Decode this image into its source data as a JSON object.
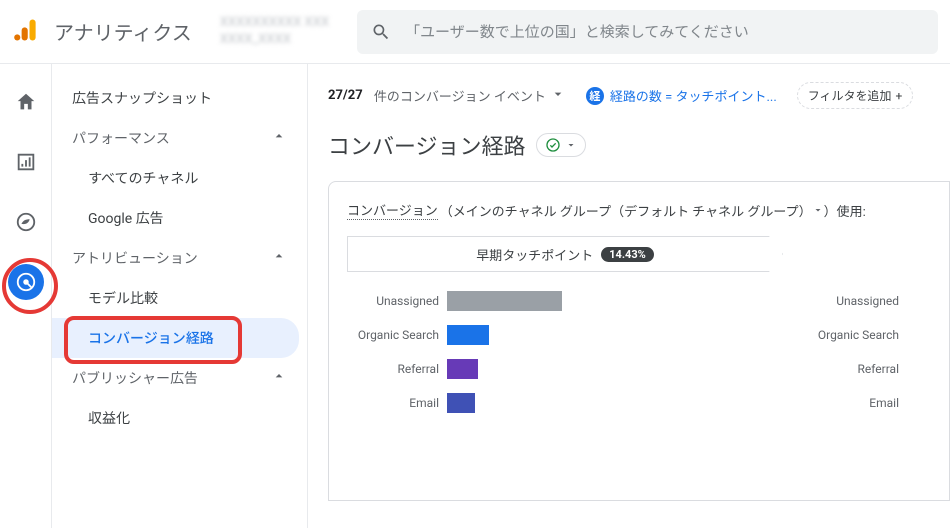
{
  "header": {
    "product": "アナリティクス",
    "property_line1": "XXXXXXXXXX XXX",
    "property_line2": "XXXX_XXXX",
    "search_placeholder": "「ユーザー数で上位の国」と検索してみてください"
  },
  "sidebar": {
    "snapshot": "広告スナップショット",
    "performance": {
      "label": "パフォーマンス",
      "items": [
        "すべてのチャネル",
        "Google 広告"
      ]
    },
    "attribution": {
      "label": "アトリビューション",
      "items": [
        "モデル比較",
        "コンバージョン経路"
      ],
      "selected_index": 1
    },
    "publisher": {
      "label": "パブリッシャー広告",
      "items": [
        "収益化"
      ]
    }
  },
  "controls": {
    "event_count": "27/27",
    "event_label": "件のコンバージョン イベント",
    "path_chip_badge": "経",
    "path_chip_label": "経路の数 = タッチポイント...",
    "filter_add": "フィルタを追加"
  },
  "page": {
    "title": "コンバージョン経路"
  },
  "card": {
    "head_prefix": "コンバージョン",
    "head_group": "（メインのチャネル グループ（デフォルト チャネル グループ）",
    "head_suffix": "）使用: ",
    "step_label": "早期タッチポイント",
    "step_pct": "14.43%"
  },
  "chart_data": {
    "type": "bar",
    "title": "早期タッチポイント",
    "categories": [
      "Unassigned",
      "Organic Search",
      "Referral",
      "Email"
    ],
    "series": [
      {
        "name": "早期タッチポイント",
        "values": [
          100,
          35,
          26,
          24
        ]
      }
    ],
    "colors": {
      "Unassigned": "#9aa0a6",
      "Organic Search": "#1a73e8",
      "Referral": "#673ab7",
      "Email": "#3f51b5"
    },
    "xlim": [
      0,
      300
    ]
  }
}
